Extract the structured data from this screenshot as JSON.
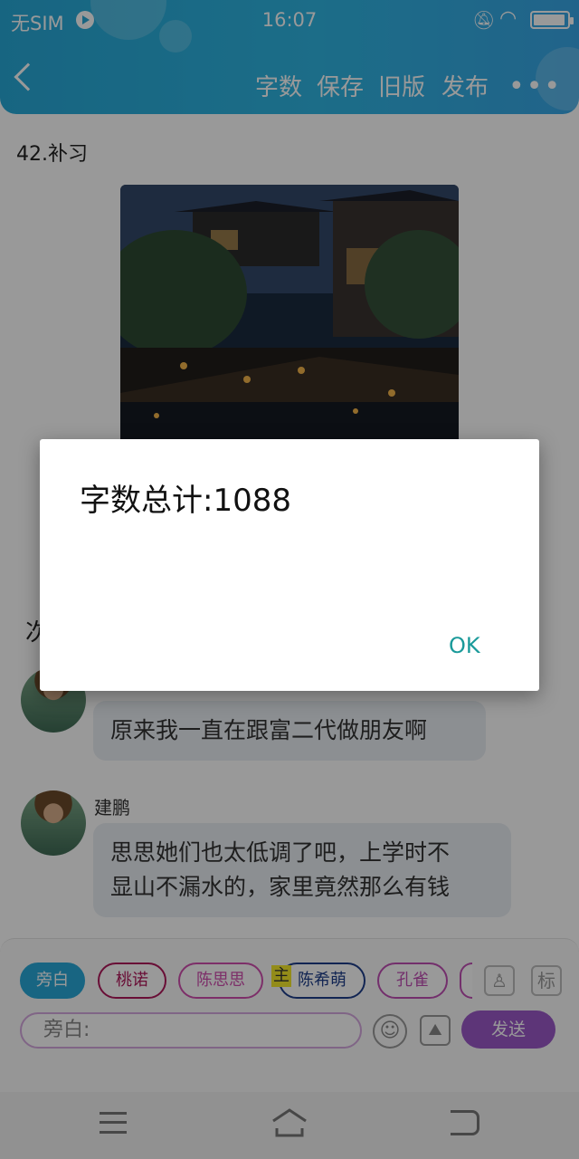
{
  "status_bar": {
    "carrier": "无SIM",
    "time": "16:07"
  },
  "header": {
    "toolbar": [
      "字数",
      "保存",
      "旧版",
      "发布"
    ],
    "more": "•••"
  },
  "content": {
    "chapter_title": "42.补习",
    "section_mark": "次",
    "messages": [
      {
        "speaker": "",
        "text": "原来我一直在跟富二代做朋友啊"
      },
      {
        "speaker": "建鹏",
        "text_lines": [
          "思思她们也太低调了吧，上学时不",
          "显山不漏水的，家里竟然那么有钱"
        ]
      }
    ]
  },
  "composer": {
    "characters": [
      {
        "name": "旁白",
        "color": "#29a9d9",
        "filled": true
      },
      {
        "name": "桃诺",
        "color": "#b0185a",
        "filled": false
      },
      {
        "name": "陈思思",
        "color": "#d14fb0",
        "filled": false
      },
      {
        "name": "陈希萌",
        "color": "#1e3f8a",
        "filled": false
      },
      {
        "name": "孔雀",
        "color": "#c04fb5",
        "filled": false
      }
    ],
    "main_tag": "主",
    "avatar_button": "♙",
    "tag_button": "标",
    "input_placeholder": "旁白:",
    "send_label": "发送"
  },
  "dialog": {
    "message": "字数总计:1088",
    "ok_label": "OK"
  }
}
